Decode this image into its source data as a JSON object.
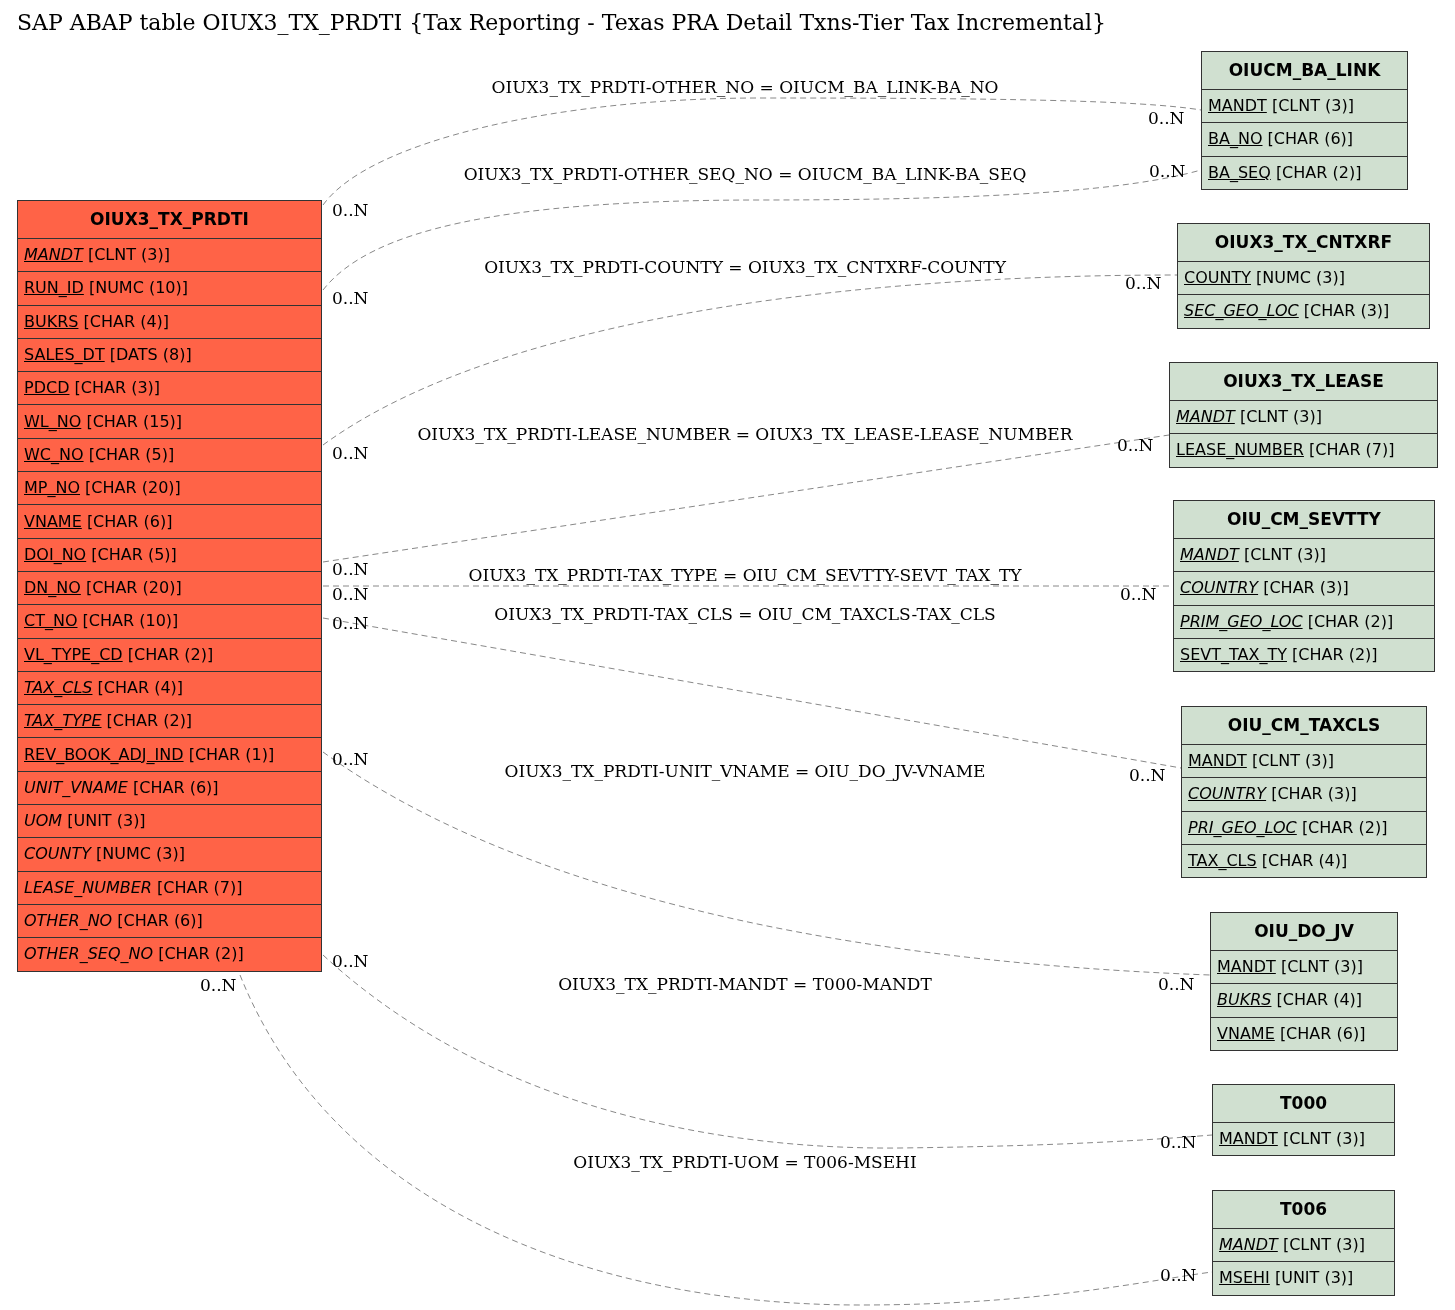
{
  "title": "SAP ABAP table OIUX3_TX_PRDTI {Tax Reporting - Texas PRA Detail Txns-Tier Tax Incremental}",
  "tables": [
    {
      "name": "OIUX3_TX_PRDTI",
      "color": "#ff6347",
      "fields": [
        {
          "name": "MANDT",
          "type": "[CLNT (3)]",
          "key": true,
          "italic": true
        },
        {
          "name": "RUN_ID",
          "type": "[NUMC (10)]",
          "key": true,
          "italic": false
        },
        {
          "name": "BUKRS",
          "type": "[CHAR (4)]",
          "key": true,
          "italic": false
        },
        {
          "name": "SALES_DT",
          "type": "[DATS (8)]",
          "key": true,
          "italic": false
        },
        {
          "name": "PDCD",
          "type": "[CHAR (3)]",
          "key": true,
          "italic": false
        },
        {
          "name": "WL_NO",
          "type": "[CHAR (15)]",
          "key": true,
          "italic": false
        },
        {
          "name": "WC_NO",
          "type": "[CHAR (5)]",
          "key": true,
          "italic": false
        },
        {
          "name": "MP_NO",
          "type": "[CHAR (20)]",
          "key": true,
          "italic": false
        },
        {
          "name": "VNAME",
          "type": "[CHAR (6)]",
          "key": true,
          "italic": false
        },
        {
          "name": "DOI_NO",
          "type": "[CHAR (5)]",
          "key": true,
          "italic": false
        },
        {
          "name": "DN_NO",
          "type": "[CHAR (20)]",
          "key": true,
          "italic": false
        },
        {
          "name": "CT_NO",
          "type": "[CHAR (10)]",
          "key": true,
          "italic": false
        },
        {
          "name": "VL_TYPE_CD",
          "type": "[CHAR (2)]",
          "key": true,
          "italic": false
        },
        {
          "name": "TAX_CLS",
          "type": "[CHAR (4)]",
          "key": true,
          "italic": true
        },
        {
          "name": "TAX_TYPE",
          "type": "[CHAR (2)]",
          "key": true,
          "italic": true
        },
        {
          "name": "REV_BOOK_ADJ_IND",
          "type": "[CHAR (1)]",
          "key": true,
          "italic": false
        },
        {
          "name": "UNIT_VNAME",
          "type": "[CHAR (6)]",
          "key": false,
          "italic": true
        },
        {
          "name": "UOM",
          "type": "[UNIT (3)]",
          "key": false,
          "italic": true
        },
        {
          "name": "COUNTY",
          "type": "[NUMC (3)]",
          "key": false,
          "italic": true
        },
        {
          "name": "LEASE_NUMBER",
          "type": "[CHAR (7)]",
          "key": false,
          "italic": true
        },
        {
          "name": "OTHER_NO",
          "type": "[CHAR (6)]",
          "key": false,
          "italic": true
        },
        {
          "name": "OTHER_SEQ_NO",
          "type": "[CHAR (2)]",
          "key": false,
          "italic": true
        }
      ]
    },
    {
      "name": "OIUCM_BA_LINK",
      "color": "#d0e0d0",
      "fields": [
        {
          "name": "MANDT",
          "type": "[CLNT (3)]",
          "key": true,
          "italic": false
        },
        {
          "name": "BA_NO",
          "type": "[CHAR (6)]",
          "key": true,
          "italic": false
        },
        {
          "name": "BA_SEQ",
          "type": "[CHAR (2)]",
          "key": true,
          "italic": false
        }
      ]
    },
    {
      "name": "OIUX3_TX_CNTXRF",
      "color": "#d0e0d0",
      "fields": [
        {
          "name": "COUNTY",
          "type": "[NUMC (3)]",
          "key": true,
          "italic": false
        },
        {
          "name": "SEC_GEO_LOC",
          "type": "[CHAR (3)]",
          "key": true,
          "italic": true
        }
      ]
    },
    {
      "name": "OIUX3_TX_LEASE",
      "color": "#d0e0d0",
      "fields": [
        {
          "name": "MANDT",
          "type": "[CLNT (3)]",
          "key": true,
          "italic": true
        },
        {
          "name": "LEASE_NUMBER",
          "type": "[CHAR (7)]",
          "key": true,
          "italic": false
        }
      ]
    },
    {
      "name": "OIU_CM_SEVTTY",
      "color": "#d0e0d0",
      "fields": [
        {
          "name": "MANDT",
          "type": "[CLNT (3)]",
          "key": true,
          "italic": true
        },
        {
          "name": "COUNTRY",
          "type": "[CHAR (3)]",
          "key": true,
          "italic": true
        },
        {
          "name": "PRIM_GEO_LOC",
          "type": "[CHAR (2)]",
          "key": true,
          "italic": true
        },
        {
          "name": "SEVT_TAX_TY",
          "type": "[CHAR (2)]",
          "key": true,
          "italic": false
        }
      ]
    },
    {
      "name": "OIU_CM_TAXCLS",
      "color": "#d0e0d0",
      "fields": [
        {
          "name": "MANDT",
          "type": "[CLNT (3)]",
          "key": true,
          "italic": false
        },
        {
          "name": "COUNTRY",
          "type": "[CHAR (3)]",
          "key": true,
          "italic": true
        },
        {
          "name": "PRI_GEO_LOC",
          "type": "[CHAR (2)]",
          "key": true,
          "italic": true
        },
        {
          "name": "TAX_CLS",
          "type": "[CHAR (4)]",
          "key": true,
          "italic": false
        }
      ]
    },
    {
      "name": "OIU_DO_JV",
      "color": "#d0e0d0",
      "fields": [
        {
          "name": "MANDT",
          "type": "[CLNT (3)]",
          "key": true,
          "italic": false
        },
        {
          "name": "BUKRS",
          "type": "[CHAR (4)]",
          "key": true,
          "italic": true
        },
        {
          "name": "VNAME",
          "type": "[CHAR (6)]",
          "key": true,
          "italic": false
        }
      ]
    },
    {
      "name": "T000",
      "color": "#d0e0d0",
      "fields": [
        {
          "name": "MANDT",
          "type": "[CLNT (3)]",
          "key": true,
          "italic": false
        }
      ]
    },
    {
      "name": "T006",
      "color": "#d0e0d0",
      "fields": [
        {
          "name": "MANDT",
          "type": "[CLNT (3)]",
          "key": true,
          "italic": true
        },
        {
          "name": "MSEHI",
          "type": "[UNIT (3)]",
          "key": true,
          "italic": false
        }
      ]
    }
  ],
  "relations": [
    {
      "label": "OIUX3_TX_PRDTI-OTHER_NO = OIUCM_BA_LINK-BA_NO",
      "from_card": "0..N",
      "to_card": "0..N"
    },
    {
      "label": "OIUX3_TX_PRDTI-OTHER_SEQ_NO = OIUCM_BA_LINK-BA_SEQ",
      "from_card": "0..N",
      "to_card": "0..N"
    },
    {
      "label": "OIUX3_TX_PRDTI-COUNTY = OIUX3_TX_CNTXRF-COUNTY",
      "from_card": "0..N",
      "to_card": "0..N"
    },
    {
      "label": "OIUX3_TX_PRDTI-LEASE_NUMBER = OIUX3_TX_LEASE-LEASE_NUMBER",
      "from_card": "0..N",
      "to_card": "0..N"
    },
    {
      "label": "OIUX3_TX_PRDTI-TAX_TYPE = OIU_CM_SEVTTY-SEVT_TAX_TY",
      "from_card": "0..N",
      "to_card": "0..N"
    },
    {
      "label": "OIUX3_TX_PRDTI-TAX_CLS = OIU_CM_TAXCLS-TAX_CLS",
      "from_card": "0..N",
      "to_card": "0..N"
    },
    {
      "label": "OIUX3_TX_PRDTI-UNIT_VNAME = OIU_DO_JV-VNAME",
      "from_card": "0..N",
      "to_card": "0..N"
    },
    {
      "label": "OIUX3_TX_PRDTI-MANDT = T000-MANDT",
      "from_card": "0..N",
      "to_card": "0..N"
    },
    {
      "label": "OIUX3_TX_PRDTI-UOM = T006-MSEHI",
      "from_card": "0..N",
      "to_card": "0..N"
    }
  ]
}
